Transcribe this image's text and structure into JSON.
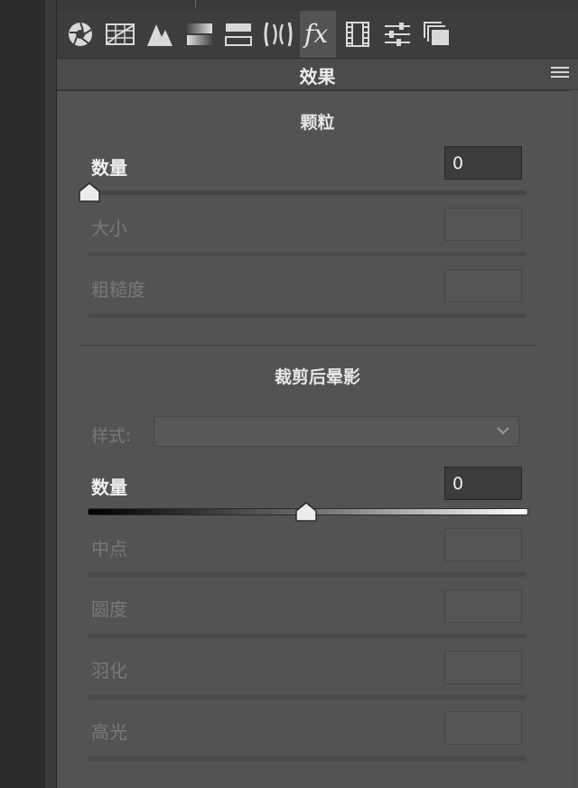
{
  "toolbar": {
    "tools": [
      {
        "icon": "aperture-icon"
      },
      {
        "icon": "histogram-grid-icon"
      },
      {
        "icon": "tone-curve-icon"
      },
      {
        "icon": "split-gradient-icon"
      },
      {
        "icon": "hsl-panel-icon"
      },
      {
        "icon": "lens-icon"
      },
      {
        "icon": "fx-effects-icon",
        "glyph": "fx",
        "active": true
      },
      {
        "icon": "film-strip-icon"
      },
      {
        "icon": "sliders-icon"
      },
      {
        "icon": "snapshots-icon"
      }
    ]
  },
  "panel": {
    "title": "效果"
  },
  "grain": {
    "title": "颗粒",
    "amount": {
      "label": "数量",
      "value": "0",
      "level": 0
    },
    "size": {
      "label": "大小",
      "value": ""
    },
    "roughness": {
      "label": "粗糙度",
      "value": ""
    }
  },
  "vignette": {
    "title": "裁剪后晕影",
    "style": {
      "label": "样式:",
      "selected": ""
    },
    "amount": {
      "label": "数量",
      "value": "0",
      "level": 0.5
    },
    "midpoint": {
      "label": "中点",
      "value": ""
    },
    "roundness": {
      "label": "圆度",
      "value": ""
    },
    "feather": {
      "label": "羽化",
      "value": ""
    },
    "highlights": {
      "label": "高光",
      "value": ""
    }
  },
  "colors": {
    "panel_bg": "#535353",
    "toolbar_bg": "#3d3d3d",
    "text_on": "#f0f0f0",
    "text_disabled": "#787878"
  }
}
